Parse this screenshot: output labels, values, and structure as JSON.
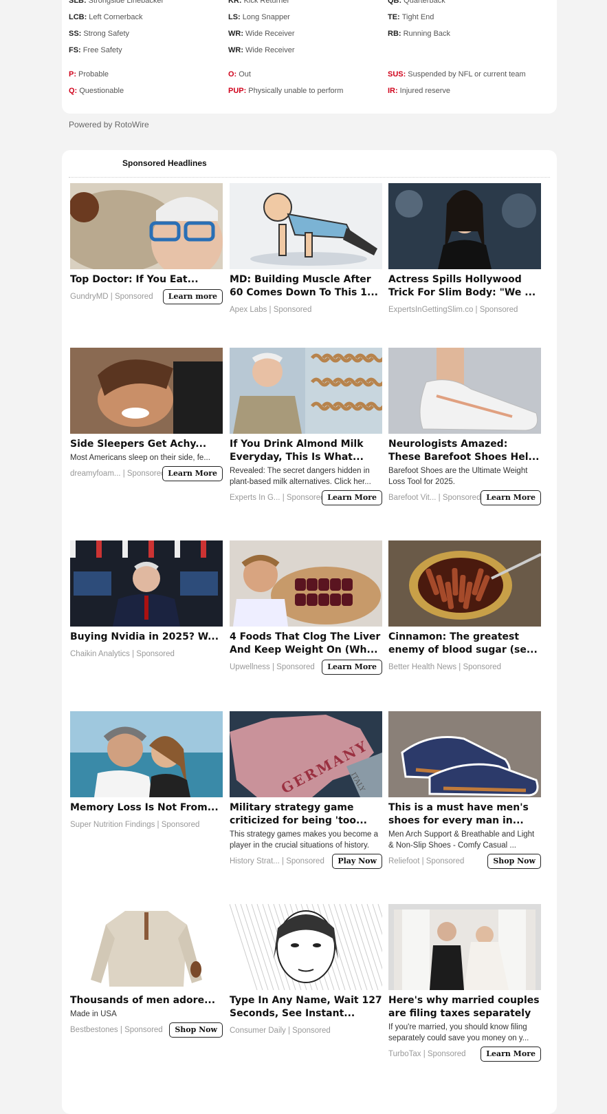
{
  "legend": {
    "positions": [
      [
        {
          "abbr": "SLB:",
          "text": "Strongside Linebacker"
        },
        {
          "abbr": "KR:",
          "text": "Kick Returner"
        },
        {
          "abbr": "QB:",
          "text": "Quarterback"
        }
      ],
      [
        {
          "abbr": "LCB:",
          "text": "Left Cornerback"
        },
        {
          "abbr": "LS:",
          "text": "Long Snapper"
        },
        {
          "abbr": "TE:",
          "text": "Tight End"
        }
      ],
      [
        {
          "abbr": "SS:",
          "text": "Strong Safety"
        },
        {
          "abbr": "WR:",
          "text": "Wide Receiver"
        },
        {
          "abbr": "RB:",
          "text": "Running Back"
        }
      ],
      [
        {
          "abbr": "FS:",
          "text": "Free Safety"
        },
        {
          "abbr": "WR:",
          "text": "Wide Receiver"
        },
        null
      ]
    ],
    "statuses": [
      [
        {
          "abbr": "P:",
          "text": "Probable"
        },
        {
          "abbr": "O:",
          "text": "Out"
        },
        {
          "abbr": "SUS:",
          "text": "Suspended by NFL or current team"
        }
      ],
      [
        {
          "abbr": "Q:",
          "text": "Questionable"
        },
        {
          "abbr": "PUP:",
          "text": "Physically unable to perform"
        },
        {
          "abbr": "IR:",
          "text": "Injured reserve"
        }
      ]
    ]
  },
  "powered_by": "Powered by RotoWire",
  "sponsored": {
    "title": "Sponsored Headlines",
    "ads": [
      {
        "headline": "Top Doctor: If You Eat...",
        "desc": "",
        "source": "GundryMD | Sponsored",
        "cta": "Learn more",
        "image": "oatmeal-doctor-photo"
      },
      {
        "headline": "MD: Building Muscle After 60 Comes Down To This 1...",
        "desc": "",
        "source": "Apex Labs | Sponsored",
        "cta": "",
        "image": "old-man-pushup-illustration"
      },
      {
        "headline": "Actress Spills Hollywood Trick For Slim Body: \"We ...",
        "desc": "",
        "source": "ExpertsInGettingSlim.co | Sponsored",
        "cta": "",
        "image": "actress-photo"
      },
      {
        "headline": "Side Sleepers Get Achy...",
        "desc": "Most Americans sleep on their side, fe...",
        "source": "dreamyfoam... | Sponsored",
        "cta": "Learn More",
        "image": "woman-pillow-photo"
      },
      {
        "headline": "If You Drink Almond Milk Everyday, This Is What...",
        "desc": "Revealed: The secret dangers hidden in plant-based milk alternatives. Click her...",
        "source": "Experts In G... | Sponsored",
        "cta": "Learn More",
        "image": "doctor-worms-photo"
      },
      {
        "headline": "Neurologists Amazed: These Barefoot Shoes Hel...",
        "desc": "Barefoot Shoes are the Ultimate Weight Loss Tool for 2025.",
        "source": "Barefoot Vit...  | Sponsored",
        "cta": "Learn More",
        "image": "white-shoe-photo"
      },
      {
        "headline": "Buying Nvidia in 2025? W...",
        "desc": "",
        "source": "Chaikin Analytics | Sponsored",
        "cta": "",
        "image": "trading-floor-photo"
      },
      {
        "headline": "4 Foods That Clog The Liver And Keep Weight On (Wh...",
        "desc": "",
        "source": "Upwellness | Sponsored",
        "cta": "Learn More",
        "image": "liver-plate-photo"
      },
      {
        "headline": "Cinnamon: The greatest enemy of blood sugar (se...",
        "desc": "",
        "source": "Better Health News | Sponsored",
        "cta": "",
        "image": "cinnamon-bowl-photo"
      },
      {
        "headline": "Memory Loss Is Not From...",
        "desc": "",
        "source": "Super Nutrition Findings | Sponsored",
        "cta": "",
        "image": "couple-beach-photo"
      },
      {
        "headline": "Military strategy game criticized for being 'too...",
        "desc": "This strategy games makes you become a player in the crucial situations of history.",
        "source": "History Strat... | Sponsored",
        "cta": "Play Now",
        "image": "germany-map",
        "map_label": "GERMANY",
        "map_label2": "ITALY"
      },
      {
        "headline": "This is a must have men's shoes for every man in...",
        "desc": "Men Arch Support & Breathable and Light & Non-Slip Shoes - Comfy Casual ...",
        "source": "Reliefoot | Sponsored",
        "cta": "Shop Now",
        "image": "navy-sneakers-photo"
      },
      {
        "headline": "Thousands of men adore...",
        "desc": "Made in USA",
        "source": "Bestbestones | Sponsored",
        "cta": "Shop Now",
        "image": "sweater-photo"
      },
      {
        "headline": "Type In Any Name, Wait 127 Seconds, See Instant...",
        "desc": "",
        "source": "Consumer Daily | Sponsored",
        "cta": "",
        "image": "sketch-face"
      },
      {
        "headline": "Here's why married couples are filing taxes separately",
        "desc": "If you're married, you should know filing separately could save you money on y...",
        "source": "TurboTax | Sponsored",
        "cta": "Learn More",
        "image": "wedding-couple-photo"
      }
    ]
  }
}
